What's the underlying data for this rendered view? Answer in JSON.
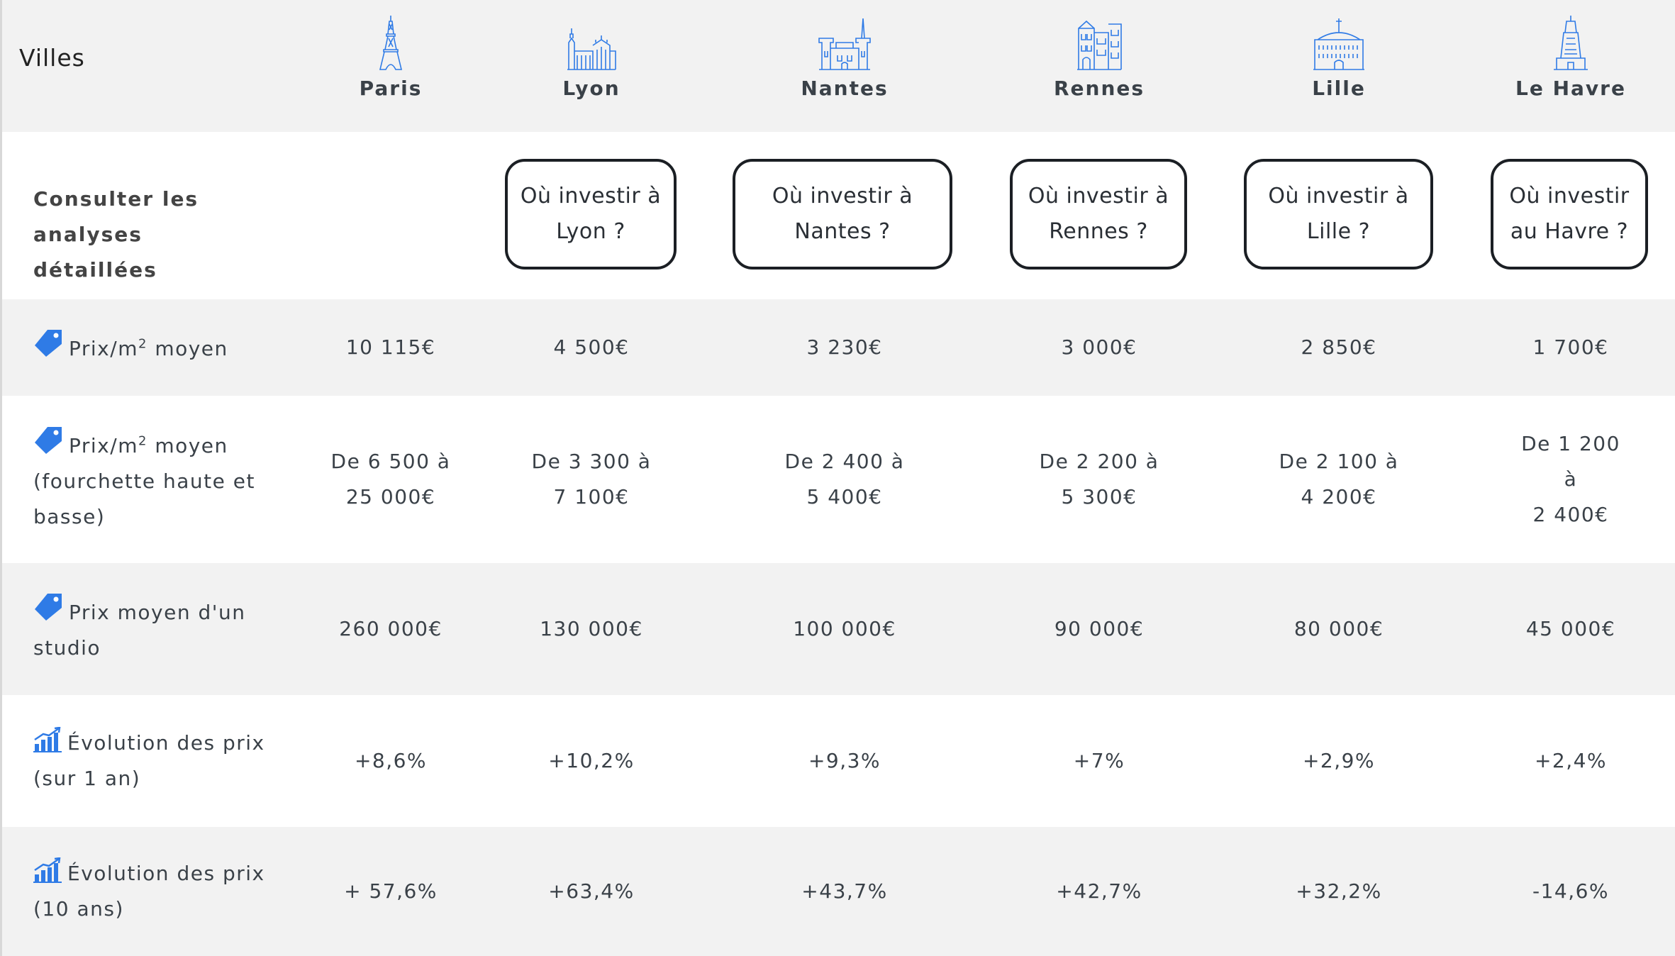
{
  "header": {
    "villes_label": "Villes",
    "cities": [
      {
        "name": "Paris",
        "icon": "eiffel-tower-icon"
      },
      {
        "name": "Lyon",
        "icon": "lyon-cathedral-icon"
      },
      {
        "name": "Nantes",
        "icon": "nantes-castle-icon"
      },
      {
        "name": "Rennes",
        "icon": "rennes-building-icon"
      },
      {
        "name": "Lille",
        "icon": "lille-belfry-icon"
      },
      {
        "name": "Le Havre",
        "icon": "le-havre-tower-icon"
      }
    ]
  },
  "analyses": {
    "label_line1": "Consulter les",
    "label_line2": "analyses détaillées",
    "buttons": [
      {
        "line1": "Où investir à",
        "line2": "Lyon ?"
      },
      {
        "line1": "Où investir à",
        "line2": "Nantes ?"
      },
      {
        "line1": "Où investir à",
        "line2": "Rennes ?"
      },
      {
        "line1": "Où investir à",
        "line2": "Lille ?"
      },
      {
        "line1": "Où investir",
        "line2": "au Havre ?"
      }
    ]
  },
  "rows": {
    "prix_m2": {
      "label_pre": "Prix/m",
      "label_sup": "2",
      "label_post": " moyen",
      "icon": "price-tag-icon",
      "values": [
        "10 115€",
        "4 500€",
        "3 230€",
        "3 000€",
        "2 850€",
        "1 700€"
      ]
    },
    "fourchette": {
      "label_pre": "Prix/m",
      "label_sup": "2",
      "label_post": " moyen",
      "label_line2": "(fourchette haute et",
      "label_line3": "basse)",
      "icon": "price-tag-icon",
      "values": [
        {
          "line1": "De 6 500 à",
          "line2": "25 000€"
        },
        {
          "line1": "De 3 300 à",
          "line2": "7 100€"
        },
        {
          "line1": "De 2 400 à",
          "line2": "5 400€"
        },
        {
          "line1": "De 2 200 à",
          "line2": "5 300€"
        },
        {
          "line1": "De 2 100 à",
          "line2": "4 200€"
        },
        {
          "line1": "De 1 200 à",
          "line2": "2 400€"
        }
      ]
    },
    "studio": {
      "label_line1": "Prix moyen d'un",
      "label_line2": "studio",
      "icon": "price-tag-icon",
      "values": [
        "260 000€",
        "130 000€",
        "100 000€",
        "90 000€",
        "80 000€",
        "45 000€"
      ]
    },
    "evol_1an": {
      "label_line1": "Évolution des prix",
      "label_line2": "(sur 1 an)",
      "icon": "growth-chart-icon",
      "values": [
        "+8,6%",
        "+10,2%",
        "+9,3%",
        "+7%",
        "+2,9%",
        "+2,4%"
      ]
    },
    "evol_10ans": {
      "label_line1": "Évolution des prix",
      "label_line2": "(10 ans)",
      "icon": "growth-chart-icon",
      "values": [
        "+ 57,6%",
        "+63,4%",
        "+43,7%",
        "+42,7%",
        "+32,2%",
        "-14,6%"
      ]
    }
  },
  "colors": {
    "icon_blue": "#2f7be6",
    "row_gray": "#f2f2f2",
    "button_border": "#1b1f24"
  }
}
